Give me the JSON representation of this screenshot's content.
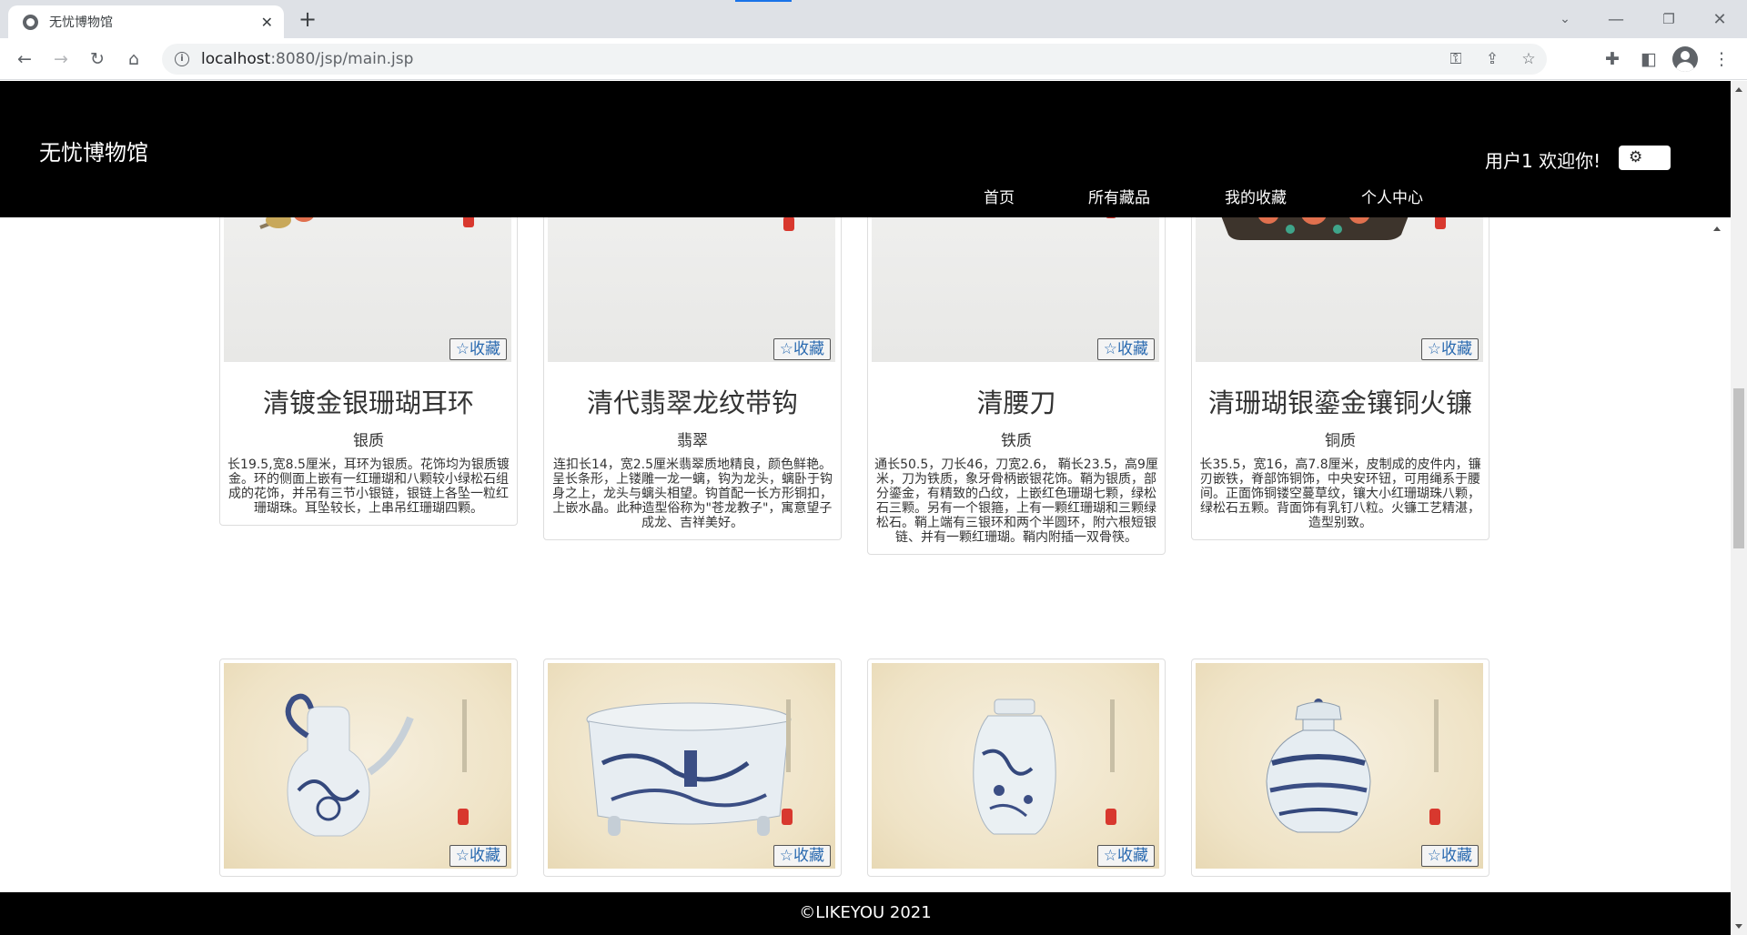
{
  "browser": {
    "tab_title": "无忧博物馆",
    "url_host": "localhost",
    "url_rest": ":8080/jsp/main.jsp"
  },
  "site": {
    "brand": "无忧博物馆",
    "welcome": "用户1 欢迎你!",
    "nav": [
      "首页",
      "所有藏品",
      "我的收藏",
      "个人中心"
    ],
    "footer": "©LIKEYOU 2021"
  },
  "fav_label": "☆收藏",
  "items": [
    {
      "title": "清镀金银珊瑚耳环",
      "material": "银质",
      "desc": "长19.5,宽8.5厘米，耳环为银质。花饰均为银质镀金。环的侧面上嵌有一红珊瑚和八颗较小绿松石组成的花饰，并吊有三节小银链，银链上各坠一粒红珊瑚珠。耳坠较长，上串吊红珊瑚四颗。"
    },
    {
      "title": "清代翡翠龙纹带钩",
      "material": "翡翠",
      "desc": "连扣长14，宽2.5厘米翡翠质地精良，颜色鲜艳。呈长条形，上镂雕一龙一螭，钩为龙头，螭卧于钩身之上，龙头与螭头相望。钩首配一长方形铜扣，上嵌水晶。此种造型俗称为\"苍龙教子\"，寓意望子成龙、吉祥美好。"
    },
    {
      "title": "清腰刀",
      "material": "铁质",
      "desc": "通长50.5，刀长46，刀宽2.6， 鞘长23.5，高9厘米，刀为铁质，象牙骨柄嵌银花饰。鞘为银质，部分鎏金，有精致的凸纹，上嵌红色珊瑚七颗，绿松石三颗。另有一个银箍，上有一颗红珊瑚和三颗绿松石。鞘上端有三银环和两个半圆环，附六根短银链、并有一颗红珊瑚。鞘内附插一双骨筷。"
    },
    {
      "title": "清珊瑚银鎏金镶铜火镰",
      "material": "铜质",
      "desc": "长35.5，宽16，高7.8厘米，皮制成的皮件内，镰刃嵌铁，脊部饰铜饰，中央安环钮，可用绳系于腰间。正面饰铜镂空蔓草纹，镶大小红珊瑚珠八颗，绿松石五颗。背面饰有乳钉八粒。火镰工艺精湛，造型别致。"
    }
  ]
}
